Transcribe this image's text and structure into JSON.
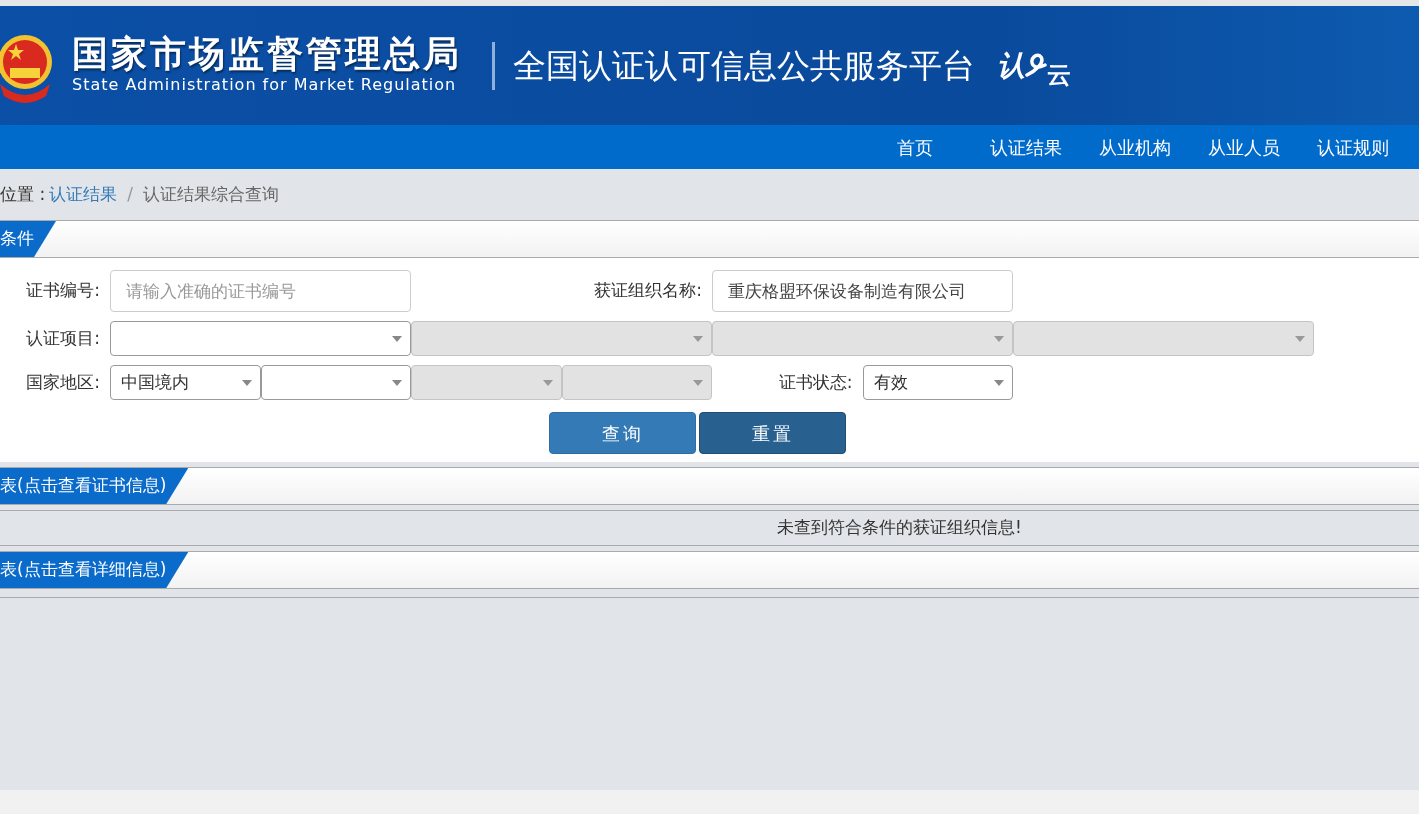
{
  "header": {
    "agency": "国家市场监督管理总局",
    "agency_en": "State Administration  for  Market Regulation",
    "platform": "全国认证认可信息公共服务平台",
    "logo": {
      "left": "认",
      "right": "云"
    }
  },
  "nav": [
    "首页",
    "认证结果",
    "从业机构",
    "从业人员",
    "认证规则"
  ],
  "breadcrumb": {
    "prefix": "位置 :",
    "separator": "/",
    "items": [
      {
        "text": "认证结果",
        "link": true
      },
      {
        "text": "认证结果综合查询",
        "link": false
      }
    ]
  },
  "search_panel": {
    "title": "条件",
    "rows": [
      [
        {
          "kind": "label",
          "text": "证书编号:"
        },
        {
          "kind": "input",
          "placeholder": "请输入准确的证书编号"
        },
        {
          "kind": "label",
          "text": "获证组织名称:"
        },
        {
          "kind": "input",
          "value": "重庆格盟环保设备制造有限公司"
        }
      ],
      [
        {
          "kind": "label",
          "text": "认证项目:"
        },
        {
          "kind": "select",
          "disabled": false
        },
        {
          "kind": "select",
          "disabled": true
        },
        {
          "kind": "select",
          "disabled": true
        },
        {
          "kind": "select",
          "disabled": true
        }
      ],
      [
        {
          "kind": "label",
          "text": "国家地区:"
        },
        {
          "kind": "select",
          "value": "中国境内",
          "disabled": false
        },
        {
          "kind": "select",
          "disabled": false
        },
        {
          "kind": "select",
          "disabled": true
        },
        {
          "kind": "select",
          "disabled": true
        },
        {
          "kind": "label",
          "text": "证书状态:"
        },
        {
          "kind": "select",
          "value": "有效",
          "disabled": false
        }
      ]
    ],
    "buttons": [
      {
        "label": "查询",
        "kind": "primary"
      },
      {
        "label": "重置",
        "kind": "secondary"
      }
    ]
  },
  "sections": [
    {
      "title": "表(点击查看证书信息)",
      "message": "未查到符合条件的获证组织信息!"
    },
    {
      "title": "表(点击查看详细信息)"
    }
  ]
}
